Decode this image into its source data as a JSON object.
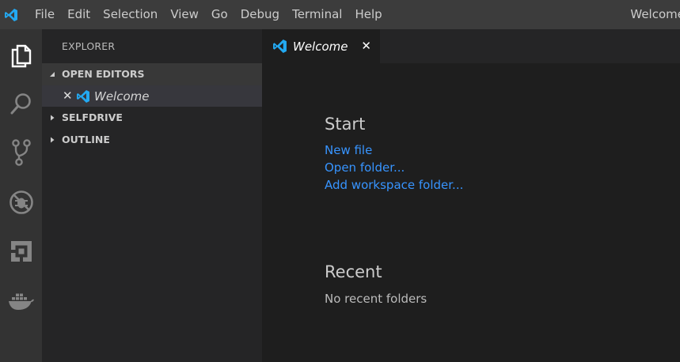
{
  "menubar": {
    "items": [
      "File",
      "Edit",
      "Selection",
      "View",
      "Go",
      "Debug",
      "Terminal",
      "Help"
    ],
    "window_title": "Welcome"
  },
  "activity_bar": {
    "icons": [
      "files-icon",
      "search-icon",
      "source-control-icon",
      "debug-icon",
      "extensions-icon",
      "docker-icon"
    ]
  },
  "sidebar": {
    "title": "EXPLORER",
    "sections": {
      "open_editors": "OPEN EDITORS",
      "selfdrive": "SELFDRIVE",
      "outline": "OUTLINE"
    },
    "open_editor_items": [
      {
        "close": "✕",
        "label": "Welcome"
      }
    ]
  },
  "tabs": [
    {
      "label": "Welcome",
      "close": "✕",
      "active": true
    }
  ],
  "welcome": {
    "start_heading": "Start",
    "start_links": [
      "New file",
      "Open folder...",
      "Add workspace folder..."
    ],
    "recent_heading": "Recent",
    "recent_empty": "No recent folders"
  },
  "colors": {
    "titlebar": "#3c3c3c",
    "activity_bar": "#333333",
    "sidebar": "#252526",
    "editor": "#1e1e1e",
    "link": "#3794ff",
    "vscode_blue": "#23a9f2"
  }
}
